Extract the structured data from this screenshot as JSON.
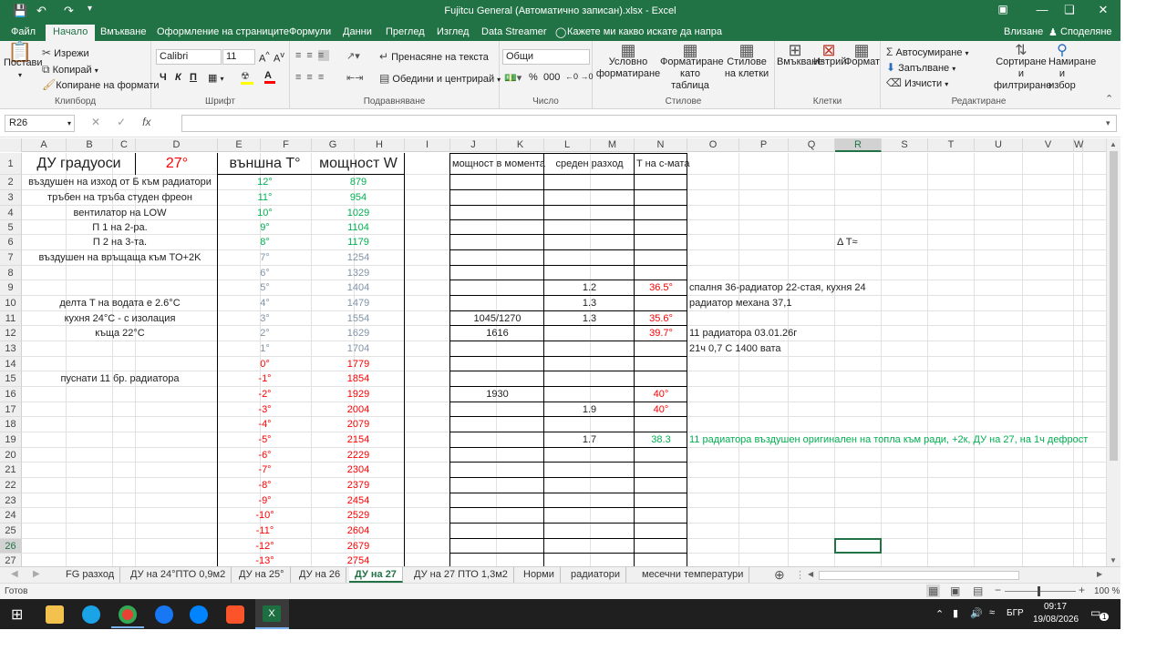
{
  "window": {
    "title": "Fujitcu General (Автоматично записан).xlsx - Excel",
    "login": "Влизане",
    "share": "Споделяне"
  },
  "ribbon_tabs": [
    "Файл",
    "Начало",
    "Вмъкване",
    "Оформление на страниците",
    "Формули",
    "Данни",
    "Преглед",
    "Изглед",
    "Data Streamer"
  ],
  "active_tab": "Начало",
  "tell_me": "Кажете ми какво искате да напра",
  "ribbon": {
    "clipboard": {
      "paste": "Постави",
      "cut": "Изрежи",
      "copy": "Копирай",
      "format_painter": "Копиране на формати",
      "label": "Клипборд"
    },
    "font": {
      "name": "Calibri",
      "size": "11",
      "bold": "Ч",
      "italic": "К",
      "underline": "П",
      "label": "Шрифт"
    },
    "alignment": {
      "wrap": "Пренасяне на текста",
      "merge": "Обедини и центрирай",
      "label": "Подравняване"
    },
    "number": {
      "format": "Общи",
      "label": "Число"
    },
    "styles": {
      "conditional": "Условно форматиране",
      "as_table": "Форматиране като таблица",
      "cell_styles": "Стилове на клетки",
      "label": "Стилове"
    },
    "cells": {
      "insert": "Вмъкване",
      "delete": "Изтрий",
      "format": "Формат",
      "label": "Клетки"
    },
    "editing": {
      "autosum": "Автосумиране",
      "fill": "Запълване",
      "clear": "Изчисти",
      "sort": "Сортиране и филтриране",
      "find": "Намиране и избор",
      "label": "Редактиране"
    }
  },
  "formula_bar": {
    "name_box": "R26",
    "fx": "fx",
    "value": ""
  },
  "columns": [
    "A",
    "B",
    "C",
    "D",
    "E",
    "F",
    "G",
    "H",
    "I",
    "J",
    "K",
    "L",
    "M",
    "N",
    "O",
    "P",
    "Q",
    "R",
    "S",
    "T",
    "U",
    "V",
    "W"
  ],
  "selected_column": "R",
  "rows": [
    "1",
    "2",
    "3",
    "4",
    "5",
    "6",
    "7",
    "8",
    "9",
    "10",
    "11",
    "12",
    "13",
    "14",
    "15",
    "16",
    "17",
    "18",
    "19",
    "20",
    "21",
    "22",
    "23",
    "24",
    "25",
    "26",
    "27"
  ],
  "selected_row": "26",
  "cells": {
    "A1": "ДУ градуоси",
    "D1": "27°",
    "E1": "външна T°",
    "G1": "мощност W",
    "J1": "мощност в момента",
    "L1": "среден разход",
    "N1": "T на с-мата",
    "A2": "въздушен на изход от Б към радиатори",
    "A3": "тръбен на тръба студен фреон",
    "A4": "вентилатор на LOW",
    "A5": "П 1 на 2-ра.",
    "A6": "П 2 на 3-та.",
    "A7": "въздушен на връщаща към TO+2K",
    "A10": "делта T на водата е 2.6°C",
    "A11": "кухня 24°C - с изолация",
    "A12": "къща 22°C",
    "A15": "пуснати 11 бр. радиатора",
    "R6": "Δ T≈",
    "L9": "1.2",
    "N9": "36.5°",
    "O9": "спалня 36-радиатор 22-стая, кухня 24",
    "L10": "1.3",
    "O10": "радиатор механа 37,1",
    "J11": "1045/1270",
    "L11": "1.3",
    "N11": "35.6°",
    "J12": "1616",
    "N12": "39.7°",
    "O12": "11 радиатора 03.01.26г",
    "O13": "21ч 0,7 С 1400 вата",
    "J16": "1930",
    "N16": "40°",
    "L17": "1.9",
    "N17": "40°",
    "L19": "1.7",
    "N19": "38.3",
    "O19": "11 радиатора въздушен оригинален на топла към ради, +2к, ДУ на 27, на 1ч дефрост"
  },
  "outside_temps": [
    "12°",
    "11°",
    "10°",
    "9°",
    "8°",
    "7°",
    "6°",
    "5°",
    "4°",
    "3°",
    "2°",
    "1°",
    "0°",
    "-1°",
    "-2°",
    "-3°",
    "-4°",
    "-5°",
    "-6°",
    "-7°",
    "-8°",
    "-9°",
    "-10°",
    "-11°",
    "-12°",
    "-13°"
  ],
  "power_values": [
    "879",
    "954",
    "1029",
    "1104",
    "1179",
    "1254",
    "1329",
    "1404",
    "1479",
    "1554",
    "1629",
    "1704",
    "1779",
    "1854",
    "1929",
    "2004",
    "2079",
    "2154",
    "2229",
    "2304",
    "2379",
    "2454",
    "2529",
    "2604",
    "2679",
    "2754"
  ],
  "colors": {
    "green": "#00b050",
    "grey": "#7f93a8",
    "red": "#ff0000",
    "excel": "#217346"
  },
  "sheet_tabs": [
    "FG разход",
    "ДУ на 24°ПТО 0,9м2",
    "ДУ на 25°",
    "ДУ на 26",
    "ДУ на 27",
    "ДУ на 27 ПТО 1,3м2",
    "Норми",
    "радиатори",
    "месечни температури"
  ],
  "active_sheet": "ДУ на 27",
  "status": {
    "ready": "Готов",
    "zoom": "100 %"
  },
  "taskbar": {
    "lang": "БГР",
    "time": "09:17",
    "date": "19/08/2026",
    "notifications": "1"
  }
}
